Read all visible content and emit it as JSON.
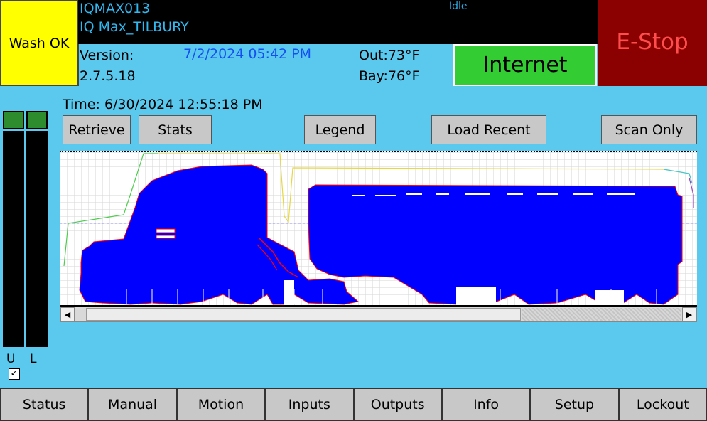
{
  "header": {
    "wash_status": "Wash OK",
    "unit_id": "IQMAX013",
    "site_name": "IQ Max_TILBURY",
    "state": "Idle",
    "version_label": "Version:",
    "version_value": "2.7.5.18",
    "system_datetime": "7/2/2024 05:42 PM",
    "temp_out": "Out:73°F",
    "temp_bay": "Bay:76°F",
    "internet_label": "Internet",
    "estop_label": "E-Stop"
  },
  "meters": {
    "u_label": "U",
    "l_label": "L",
    "checkbox_checked": true,
    "checkbox_glyph": "✓"
  },
  "scan": {
    "time": "Time: 6/30/2024 12:55:18 PM",
    "buttons": {
      "retrieve": "Retrieve",
      "stats": "Stats",
      "legend": "Legend",
      "load_recent": "Load Recent",
      "scan_only": "Scan Only"
    }
  },
  "scrollbar": {
    "left_arrow": "◀",
    "right_arrow": "▶"
  },
  "nav": {
    "items": [
      "Status",
      "Manual",
      "Motion",
      "Inputs",
      "Outputs",
      "Info",
      "Setup",
      "Lockout"
    ]
  },
  "colors": {
    "wash_ok": "#ffff00",
    "internet": "#33cc33",
    "estop": "#8b0000",
    "background": "#5bc8ee",
    "profile_fill": "#0000ff",
    "profile_edge": "#ff0000"
  }
}
